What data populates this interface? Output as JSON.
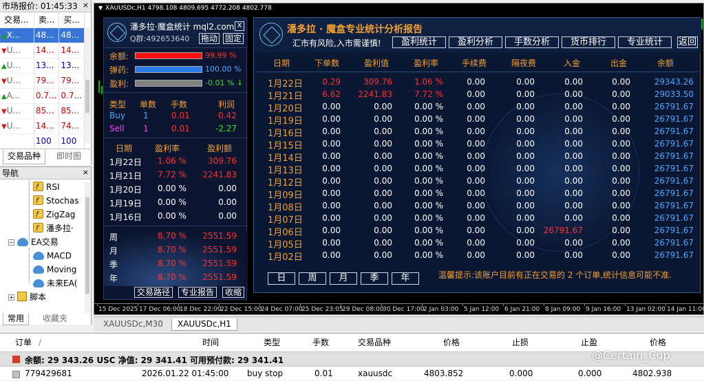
{
  "market": {
    "title": "市场报价: 01:45:33",
    "close": "×",
    "headers": [
      "交易...",
      "卖...",
      "买..."
    ],
    "rows": [
      {
        "arrow": "▲",
        "symbol": "X...",
        "bid": "48...",
        "ask": "48...",
        "dir": "up",
        "selected": true
      },
      {
        "arrow": "▼",
        "symbol": "U...",
        "bid": "14...",
        "ask": "14...",
        "dir": "down"
      },
      {
        "arrow": "▲",
        "symbol": "U...",
        "bid": "13...",
        "ask": "13...",
        "dir": "up",
        "blue": true
      },
      {
        "arrow": "▼",
        "symbol": "U...",
        "bid": "79...",
        "ask": "79...",
        "dir": "down"
      },
      {
        "arrow": "▲",
        "symbol": "A...",
        "bid": "0.7...",
        "ask": "0.7...",
        "dir": "up"
      },
      {
        "arrow": "▼",
        "symbol": "U...",
        "bid": "85...",
        "ask": "85...",
        "dir": "down"
      },
      {
        "arrow": "▼",
        "symbol": "U...",
        "bid": "14...",
        "ask": "74...",
        "dir": "down"
      },
      {
        "arrow": "",
        "symbol": "",
        "bid": "100",
        "ask": "100",
        "dir": "none",
        "blue": true
      }
    ],
    "tabs": [
      "交易品种",
      "即时图"
    ]
  },
  "navigator": {
    "title": "导航",
    "close": "×",
    "items": [
      "RSI",
      "Stochas",
      "ZigZag",
      "潘多拉·",
      "EA交易",
      "MACD",
      "Moving",
      "未来EA(",
      "脚本"
    ],
    "tabs": [
      "常用",
      "收藏夹"
    ]
  },
  "chart": {
    "ohlc": "XAUUSDc,H1  4798.108 4809.695 4772.208 4802.778",
    "time_labels": [
      "15 Dec 2025",
      "17 Dec 06:00",
      "18 Dec 22:00",
      "22 Dec 15:00",
      "24 Dec 07:00",
      "25 Dec 23:05",
      "29 Dec 08:00",
      "30 Dec 17:00",
      "2 Jan 03:00",
      "5 Jan 12:00",
      "6 Jan 21:00",
      "8 Jan 09:00",
      "9 Jan 16:00",
      "13 Jan 02:00",
      "14 Jan 11:00"
    ]
  },
  "mini": {
    "brand": "潘多拉·魔盒统计 mql2.com",
    "qq": "Q群:492653640",
    "btn_close": "X",
    "btn_drag": "拖动",
    "btn_fix": "固定",
    "balance_label": "余额:",
    "balance_pct": "99.99 %",
    "ammo_label": "弹药:",
    "ammo_pct": "100.00 %",
    "profit_label": "盈利:",
    "profit_pct": "-0.01 % ↓",
    "trade_headers": [
      "类型",
      "单数",
      "手数",
      "利润"
    ],
    "trades": [
      {
        "type": "Buy",
        "count": "1",
        "lots": "0.01",
        "profit": "0.42"
      },
      {
        "type": "Sell",
        "count": "1",
        "lots": "0.01",
        "profit": "-2.27"
      }
    ],
    "day_headers": [
      "日期",
      "盈利率",
      "盈利额"
    ],
    "days": [
      {
        "date": "1月22日",
        "rate": "1.06 %",
        "amount": "309.76",
        "red": true
      },
      {
        "date": "1月21日",
        "rate": "7.72 %",
        "amount": "2241.83",
        "red": true
      },
      {
        "date": "1月20日",
        "rate": "0.00 %",
        "amount": "0.00"
      },
      {
        "date": "1月19日",
        "rate": "0.00 %",
        "amount": "0.00"
      },
      {
        "date": "1月16日",
        "rate": "0.00 %",
        "amount": "0.00"
      }
    ],
    "periods": [
      {
        "label": "周",
        "rate": "8.70 %",
        "amount": "2551.59"
      },
      {
        "label": "月",
        "rate": "8.70 %",
        "amount": "2551.59"
      },
      {
        "label": "季",
        "rate": "8.70 %",
        "amount": "2551.59"
      },
      {
        "label": "年",
        "rate": "8.70 %",
        "amount": "2551.59"
      }
    ],
    "btn_path": "交易路径",
    "btn_report": "专业报告",
    "btn_collapse": "收缩"
  },
  "report": {
    "title": "潘多拉 · 魔盒专业统计分析报告",
    "subtitle": "汇市有风险,入市需谨慎!",
    "tabs": [
      "盈利统计",
      "盈利分析",
      "手数分析",
      "货币排行",
      "专业统计"
    ],
    "back": "返回",
    "headers": [
      "日期",
      "下单数",
      "盈利值",
      "盈利率",
      "手续费",
      "隔夜费",
      "入金",
      "出金",
      "余额"
    ],
    "rows": [
      {
        "date": "1月22日",
        "orders": "0.29",
        "profit": "309.76",
        "rate": "1.06 %",
        "fee": "0.00",
        "swap": "0.00",
        "dep": "0.00",
        "wd": "0.00",
        "bal": "29343.26",
        "red": true
      },
      {
        "date": "1月21日",
        "orders": "6.62",
        "profit": "2241.83",
        "rate": "7.72 %",
        "fee": "0.00",
        "swap": "0.00",
        "dep": "0.00",
        "wd": "0.00",
        "bal": "29033.50",
        "red": true
      },
      {
        "date": "1月20日",
        "orders": "0.00",
        "profit": "0.00",
        "rate": "0.00 %",
        "fee": "0.00",
        "swap": "0.00",
        "dep": "0.00",
        "wd": "0.00",
        "bal": "26791.67"
      },
      {
        "date": "1月19日",
        "orders": "0.00",
        "profit": "0.00",
        "rate": "0.00 %",
        "fee": "0.00",
        "swap": "0.00",
        "dep": "0.00",
        "wd": "0.00",
        "bal": "26791.67"
      },
      {
        "date": "1月16日",
        "orders": "0.00",
        "profit": "0.00",
        "rate": "0.00 %",
        "fee": "0.00",
        "swap": "0.00",
        "dep": "0.00",
        "wd": "0.00",
        "bal": "26791.67"
      },
      {
        "date": "1月15日",
        "orders": "0.00",
        "profit": "0.00",
        "rate": "0.00 %",
        "fee": "0.00",
        "swap": "0.00",
        "dep": "0.00",
        "wd": "0.00",
        "bal": "26791.67"
      },
      {
        "date": "1月14日",
        "orders": "0.00",
        "profit": "0.00",
        "rate": "0.00 %",
        "fee": "0.00",
        "swap": "0.00",
        "dep": "0.00",
        "wd": "0.00",
        "bal": "26791.67"
      },
      {
        "date": "1月13日",
        "orders": "0.00",
        "profit": "0.00",
        "rate": "0.00 %",
        "fee": "0.00",
        "swap": "0.00",
        "dep": "0.00",
        "wd": "0.00",
        "bal": "26791.67"
      },
      {
        "date": "1月12日",
        "orders": "0.00",
        "profit": "0.00",
        "rate": "0.00 %",
        "fee": "0.00",
        "swap": "0.00",
        "dep": "0.00",
        "wd": "0.00",
        "bal": "26791.67"
      },
      {
        "date": "1月09日",
        "orders": "0.00",
        "profit": "0.00",
        "rate": "0.00 %",
        "fee": "0.00",
        "swap": "0.00",
        "dep": "0.00",
        "wd": "0.00",
        "bal": "26791.67"
      },
      {
        "date": "1月08日",
        "orders": "0.00",
        "profit": "0.00",
        "rate": "0.00 %",
        "fee": "0.00",
        "swap": "0.00",
        "dep": "0.00",
        "wd": "0.00",
        "bal": "26791.67"
      },
      {
        "date": "1月07日",
        "orders": "0.00",
        "profit": "0.00",
        "rate": "0.00 %",
        "fee": "0.00",
        "swap": "0.00",
        "dep": "0.00",
        "wd": "0.00",
        "bal": "26791.67"
      },
      {
        "date": "1月06日",
        "orders": "0.00",
        "profit": "0.00",
        "rate": "0.00 %",
        "fee": "0.00",
        "swap": "0.00",
        "dep": "26791.67",
        "wd": "0.00",
        "bal": "26791.67",
        "dep_red": true
      },
      {
        "date": "1月05日",
        "orders": "0.00",
        "profit": "0.00",
        "rate": "0.00 %",
        "fee": "0.00",
        "swap": "0.00",
        "dep": "0.00",
        "wd": "0.00",
        "bal": "26791.67"
      },
      {
        "date": "1月02日",
        "orders": "0.00",
        "profit": "0.00",
        "rate": "0.00 %",
        "fee": "0.00",
        "swap": "0.00",
        "dep": "0.00",
        "wd": "0.00",
        "bal": "26791.67"
      }
    ],
    "periods": [
      "日",
      "周",
      "月",
      "季",
      "年"
    ],
    "tip": "温馨提示:该账户目前有正在交易的 2 个订单,统计信息可能不准."
  },
  "chart_tabs": [
    "XAUUSDc,M30",
    "XAUUSDc,H1"
  ],
  "terminal": {
    "headers": [
      "订单",
      "/",
      "时间",
      "类型",
      "手数",
      "交易品种",
      "价格",
      "止损",
      "止盈",
      "价格"
    ],
    "balance": "余额: 29 343.26 USC  净值: 29 341.41  可用预付款: 29 341.41",
    "order": {
      "id": "779429681",
      "time": "2026.01.22 01:45:00",
      "type": "buy stop",
      "lots": "0.01",
      "symbol": "xauusdc",
      "price": "4803.852",
      "sl": "0.000",
      "tp": "0.000",
      "cur": "4802.938"
    },
    "watermark": "@Certain_Cup"
  }
}
